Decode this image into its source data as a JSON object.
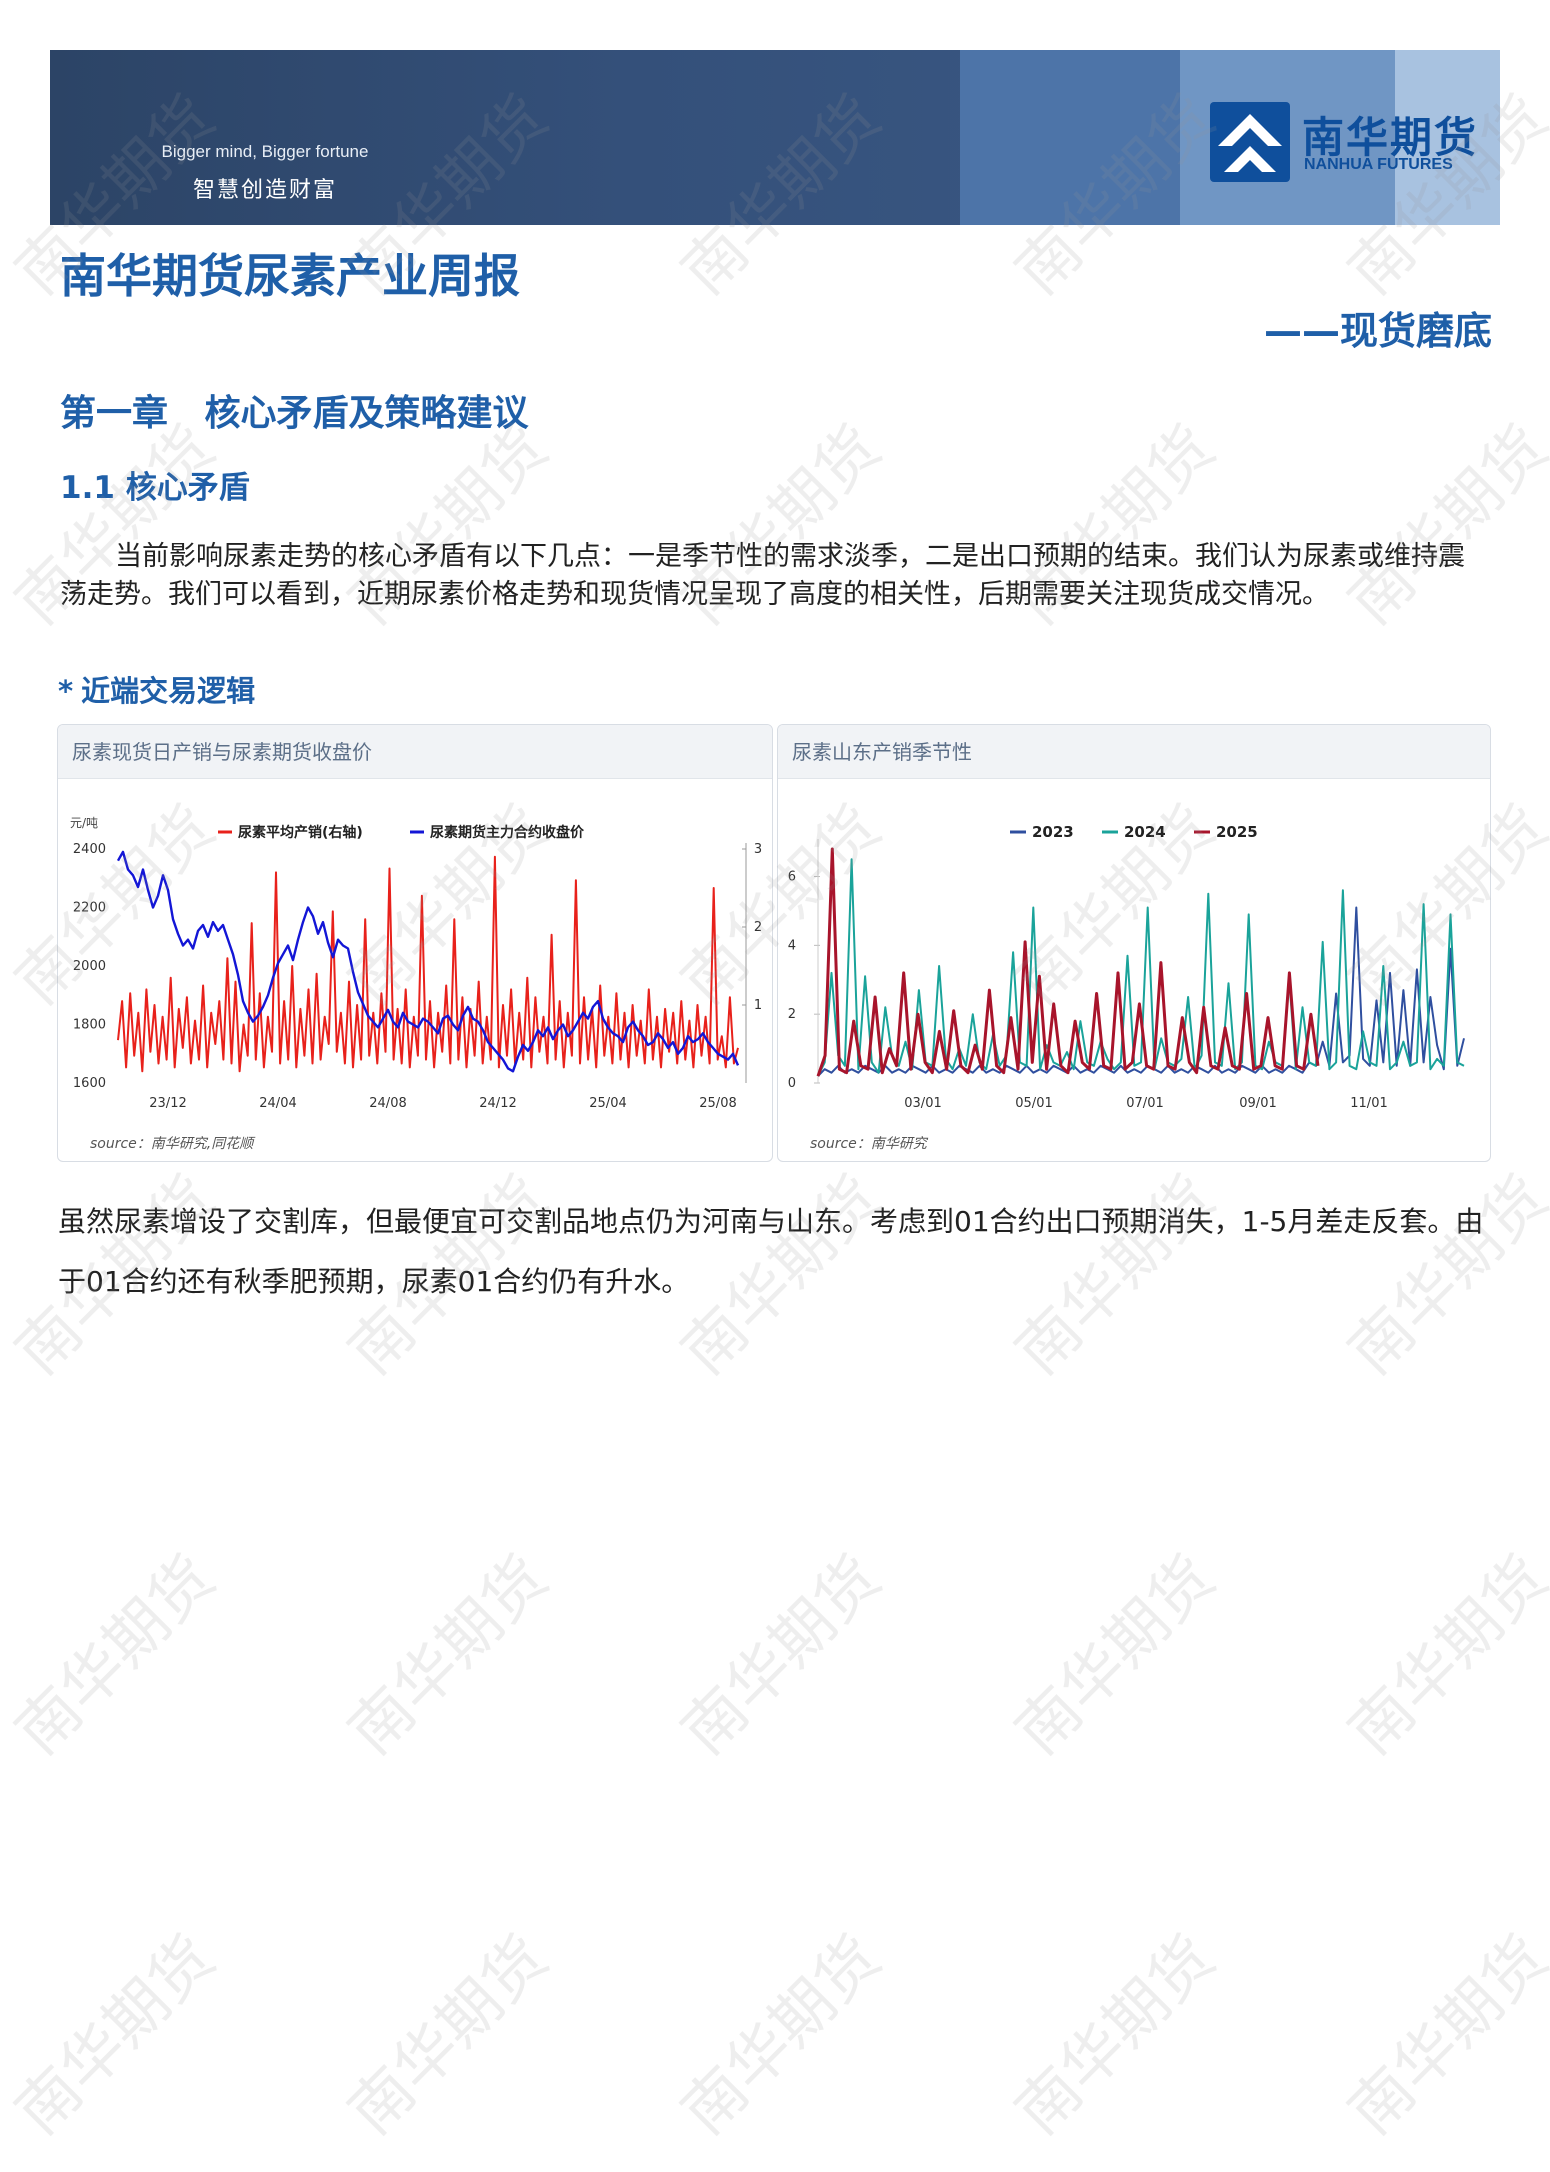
{
  "header": {
    "slogan_en": "Bigger mind, Bigger fortune",
    "slogan_zh": "智慧创造财富",
    "logo_zh": "南华期货",
    "logo_en": "NANHUA FUTURES"
  },
  "watermark_text": "南华期货",
  "report": {
    "title": "南华期货尿素产业周报",
    "subtitle": "——现货磨底",
    "chapter": "第一章 核心矛盾及策略建议",
    "section": "1.1 核心矛盾",
    "paragraph1": "当前影响尿素走势的核心矛盾有以下几点：一是季节性的需求淡季，二是出口预期的结束。我们认为尿素或维持震荡走势。我们可以看到，近期尿素价格走势和现货情况呈现了高度的相关性，后期需要关注现货成交情况。",
    "subhead": "近端交易逻辑",
    "subhead_marker": "*",
    "paragraph2": "虽然尿素增设了交割库，但最便宜可交割品地点仍为河南与山东。考虑到01合约出口预期消失，1-5月差走反套。由于01合约还有秋季肥预期，尿素01合约仍有升水。"
  },
  "chart_data": [
    {
      "type": "line",
      "title": "尿素现货日产销与尿素期货收盘价",
      "source": "source：南华研究,同花顺",
      "ylabel": "元/吨",
      "ylim": [
        1600,
        2400
      ],
      "yticks": [
        1600,
        1800,
        2000,
        2200,
        2400
      ],
      "y2lim": [
        0,
        3
      ],
      "y2ticks": [
        1,
        2,
        3
      ],
      "xticks": [
        "23/12",
        "24/04",
        "24/08",
        "24/12",
        "25/04",
        "25/08"
      ],
      "legend_position": "top-center",
      "series": [
        {
          "name": "尿素平均产销(右轴)",
          "axis": "right",
          "color": "#e8211b",
          "values": [
            0.55,
            1.05,
            0.2,
            1.15,
            0.35,
            0.9,
            0.15,
            1.2,
            0.4,
            1.0,
            0.25,
            0.85,
            0.3,
            1.35,
            0.2,
            0.95,
            0.45,
            1.1,
            0.25,
            0.8,
            0.3,
            1.25,
            0.2,
            0.9,
            0.5,
            1.05,
            0.3,
            1.6,
            0.25,
            1.3,
            0.15,
            0.75,
            0.35,
            2.05,
            0.3,
            1.15,
            0.2,
            0.85,
            0.4,
            2.7,
            0.25,
            1.05,
            0.3,
            1.5,
            0.2,
            0.95,
            0.35,
            1.2,
            0.25,
            1.4,
            0.3,
            0.85,
            0.5,
            2.2,
            0.4,
            0.9,
            0.25,
            1.3,
            0.2,
            1.0,
            0.3,
            2.1,
            0.35,
            0.9,
            0.25,
            1.15,
            0.4,
            2.75,
            0.3,
            0.95,
            0.25,
            1.2,
            0.2,
            0.85,
            0.35,
            2.4,
            0.3,
            1.05,
            0.2,
            0.9,
            0.4,
            1.25,
            0.25,
            2.1,
            0.3,
            1.1,
            0.2,
            0.95,
            0.35,
            1.3,
            0.25,
            0.85,
            0.3,
            2.9,
            0.2,
            1.0,
            0.35,
            1.2,
            0.25,
            0.9,
            0.3,
            1.35,
            0.2,
            1.1,
            0.4,
            0.85,
            0.25,
            1.9,
            0.3,
            1.05,
            0.2,
            0.9,
            0.35,
            2.6,
            0.25,
            1.1,
            0.3,
            0.95,
            0.2,
            1.25,
            0.35,
            0.85,
            0.25,
            1.15,
            0.3,
            0.9,
            0.2,
            1.0,
            0.35,
            0.8,
            0.25,
            1.2,
            0.3,
            0.85,
            0.2,
            0.95,
            0.4,
            0.9,
            0.25,
            1.05,
            0.3,
            0.8,
            0.2,
            1.0,
            0.35,
            0.85,
            0.25,
            2.5,
            0.3,
            0.6,
            0.2,
            1.1,
            0.25,
            0.45
          ]
        },
        {
          "name": "尿素期货主力合约收盘价",
          "axis": "left",
          "color": "#1316d6",
          "values": [
            2360,
            2390,
            2330,
            2310,
            2270,
            2330,
            2260,
            2200,
            2240,
            2310,
            2260,
            2160,
            2110,
            2070,
            2090,
            2060,
            2120,
            2140,
            2100,
            2150,
            2120,
            2140,
            2090,
            2040,
            1970,
            1880,
            1840,
            1810,
            1830,
            1860,
            1900,
            1960,
            2010,
            2040,
            2070,
            2020,
            2090,
            2150,
            2200,
            2170,
            2110,
            2150,
            2080,
            2030,
            2090,
            2070,
            2060,
            1980,
            1910,
            1870,
            1830,
            1810,
            1790,
            1820,
            1850,
            1810,
            1790,
            1840,
            1810,
            1800,
            1790,
            1820,
            1810,
            1790,
            1770,
            1820,
            1830,
            1800,
            1780,
            1830,
            1860,
            1820,
            1810,
            1780,
            1740,
            1720,
            1700,
            1680,
            1650,
            1640,
            1690,
            1730,
            1710,
            1740,
            1780,
            1760,
            1790,
            1750,
            1780,
            1800,
            1760,
            1780,
            1810,
            1840,
            1820,
            1860,
            1880,
            1820,
            1790,
            1770,
            1760,
            1740,
            1790,
            1810,
            1780,
            1760,
            1730,
            1740,
            1770,
            1750,
            1720,
            1740,
            1700,
            1720,
            1760,
            1740,
            1750,
            1770,
            1740,
            1720,
            1700,
            1690,
            1680,
            1700,
            1660
          ]
        }
      ]
    },
    {
      "type": "line",
      "title": "尿素山东产销季节性",
      "source": "source：南华研究",
      "ylim": [
        0,
        6.8
      ],
      "yticks": [
        0,
        2,
        4,
        6
      ],
      "xticks": [
        "03/01",
        "05/01",
        "07/01",
        "09/01",
        "11/01"
      ],
      "legend_position": "top-center",
      "series": [
        {
          "name": "2023",
          "color": "#2f4f9f",
          "values": [
            0.2,
            0.4,
            0.3,
            0.5,
            0.3,
            0.4,
            0.3,
            0.5,
            0.4,
            0.3,
            0.5,
            0.3,
            0.4,
            0.3,
            0.5,
            0.4,
            0.3,
            0.5,
            0.3,
            0.4,
            0.3,
            0.5,
            0.4,
            0.3,
            0.5,
            0.3,
            0.4,
            0.3,
            0.5,
            0.4,
            0.3,
            0.5,
            0.3,
            0.4,
            0.3,
            0.5,
            0.4,
            0.3,
            0.5,
            0.3,
            0.4,
            0.3,
            0.5,
            0.4,
            0.3,
            0.5,
            0.3,
            0.4,
            0.3,
            0.5,
            0.4,
            0.3,
            0.5,
            0.3,
            0.4,
            0.3,
            0.5,
            0.4,
            0.3,
            0.5,
            0.3,
            0.4,
            0.3,
            0.5,
            0.4,
            0.3,
            0.5,
            0.3,
            0.4,
            0.3,
            0.5,
            0.4,
            0.3,
            0.6,
            0.5,
            1.2,
            0.5,
            2.6,
            0.6,
            0.8,
            5.1,
            0.7,
            0.5,
            2.4,
            0.6,
            3.2,
            0.5,
            2.7,
            0.5,
            3.3,
            0.6,
            2.5,
            1.1,
            0.4,
            3.9,
            0.5,
            1.3
          ]
        },
        {
          "name": "2024",
          "color": "#1aa39a",
          "values": [
            0.2,
            0.6,
            3.2,
            0.8,
            0.5,
            6.5,
            0.4,
            3.1,
            0.6,
            0.3,
            2.2,
            0.8,
            0.5,
            1.2,
            0.4,
            2.7,
            0.6,
            0.5,
            3.4,
            0.7,
            0.4,
            1.0,
            0.5,
            2.0,
            0.6,
            0.4,
            1.4,
            0.5,
            0.8,
            3.8,
            0.6,
            0.5,
            5.1,
            0.4,
            1.1,
            0.6,
            0.5,
            0.9,
            0.4,
            1.8,
            0.6,
            0.5,
            1.2,
            0.7,
            0.4,
            0.6,
            3.7,
            0.5,
            0.6,
            5.1,
            0.4,
            1.3,
            0.6,
            0.5,
            0.7,
            2.5,
            0.4,
            0.8,
            5.5,
            0.6,
            0.5,
            2.9,
            0.4,
            0.6,
            4.9,
            0.5,
            0.4,
            1.2,
            0.6,
            0.5,
            3.1,
            0.4,
            2.2,
            0.6,
            0.5,
            4.1,
            0.4,
            0.6,
            5.6,
            0.5,
            0.4,
            1.5,
            0.6,
            0.5,
            3.4,
            0.4,
            0.6,
            1.2,
            0.5,
            0.6,
            5.2,
            0.4,
            0.7,
            0.5,
            4.9,
            0.6,
            0.5
          ]
        },
        {
          "name": "2025",
          "color": "#a8142b",
          "values": [
            0.2,
            0.8,
            6.8,
            0.4,
            0.3,
            1.8,
            0.5,
            0.4,
            2.5,
            0.3,
            1.0,
            0.5,
            3.2,
            0.4,
            2.0,
            0.6,
            0.3,
            1.5,
            0.4,
            2.1,
            0.5,
            0.3,
            1.1,
            0.4,
            2.7,
            0.5,
            0.3,
            1.9,
            0.4,
            4.1,
            0.6,
            3.1,
            0.4,
            2.3,
            0.5,
            0.3,
            1.8,
            0.6,
            0.4,
            2.6,
            0.5,
            0.4,
            3.2,
            0.4,
            0.6,
            2.3,
            0.5,
            0.4,
            3.5,
            0.5,
            0.4,
            1.9,
            0.6,
            0.3,
            2.2,
            0.5,
            0.4,
            1.6,
            0.5,
            0.4,
            2.6,
            0.4,
            0.5,
            1.9,
            0.5,
            0.4,
            3.2,
            0.5,
            0.4,
            2.0,
            0.5
          ]
        }
      ]
    }
  ]
}
